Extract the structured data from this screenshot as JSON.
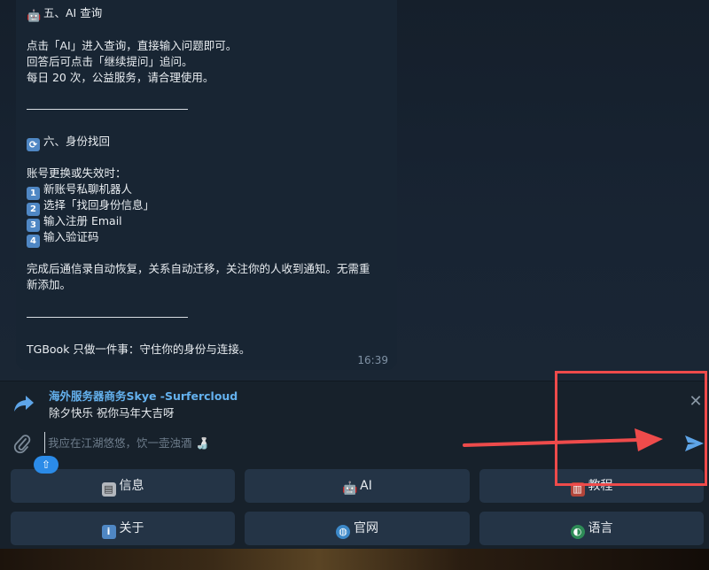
{
  "message": {
    "section5_title": "五、AI 查询",
    "section5_lines": [
      "点击「AI」进入查询，直接输入问题即可。",
      "回答后可点击「继续提问」追问。",
      "每日 20 次，公益服务，请合理使用。"
    ],
    "section6_title": "六、身份找回",
    "section6_intro": "账号更换或失效时：",
    "steps": [
      {
        "num": "1",
        "text": "新账号私聊机器人"
      },
      {
        "num": "2",
        "text": "选择「找回身份信息」"
      },
      {
        "num": "3",
        "text": "输入注册 Email"
      },
      {
        "num": "4",
        "text": "输入验证码"
      }
    ],
    "completion_line1": "完成后通信录自动恢复，关系自动迁移，关注你的人收到通知。无需重",
    "completion_line2": "新添加。",
    "closing": "TGBook 只做一件事：守住你的身份与连接。",
    "time": "16:39"
  },
  "reply": {
    "title": "海外服务器商务Skye -Surfercloud",
    "text": "除夕快乐 祝你马年大吉呀"
  },
  "input": {
    "placeholder": "我应在江湖悠悠，饮一壶浊酒 🍶"
  },
  "keyboard": {
    "row1": [
      {
        "label": "信息",
        "icon": "clipboard-icon"
      },
      {
        "label": "AI",
        "icon": "robot-icon"
      },
      {
        "label": "教程",
        "icon": "book-icon"
      }
    ],
    "row2": [
      {
        "label": "关于",
        "icon": "info-icon"
      },
      {
        "label": "官网",
        "icon": "globe-icon"
      },
      {
        "label": "语言",
        "icon": "earth-icon"
      }
    ]
  },
  "colors": {
    "accent": "#5ea5e8",
    "bubble": "#182533",
    "annotation": "#ee4b4b"
  }
}
